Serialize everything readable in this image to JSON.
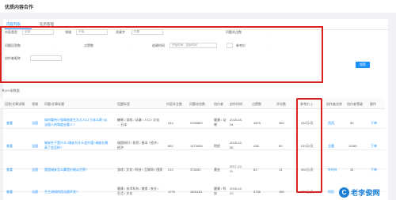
{
  "header": {
    "title": "优质内容合作"
  },
  "tabs": [
    {
      "label": "内容列表"
    },
    {
      "label": "任务管理"
    }
  ],
  "filters": {
    "content_type_label": "内容类型",
    "content_type_value": "全部",
    "domain_label": "领域",
    "domain_value": "不限",
    "keyword_label": "关键字",
    "keyword_value": "标题",
    "visits_label": "问题关注数",
    "visits_value": "-",
    "question_answer_label": "问题回答数",
    "question_answer_value": "-",
    "likes_label": "点赞数",
    "likes_value": "-",
    "create_time_label": "创建时间",
    "create_time_value": "开始时间 - 结束时间",
    "ref_label": "参考价",
    "ref_value": "-",
    "author_label": "创作者昵称",
    "search_btn": "搜索"
  },
  "summary": {
    "total": "共497条数据"
  },
  "table": {
    "headers": [
      "回答/文章详情",
      "领域",
      "问题/文章标题",
      "话题标签",
      "内容关注数",
      "问题浏览数",
      "创作者",
      "创作时间",
      "点赞数",
      "评论数",
      "参考价",
      "创作者名称",
      "创作者等级",
      "操作"
    ],
    "rows": [
      {
        "link": "查看",
        "domain": "法国",
        "title": "如何看待小强和修发生为几人口 日本么呢?从法国人的角度去看人?",
        "tags": "糖果 / 游戏 / 动漫 / 人口 / 文化 ... 日本",
        "follows": "414",
        "views": "2045563",
        "author": "健康 / 动物",
        "date": "2018-04-24",
        "likes": "4878",
        "comments": "360",
        "price": "432元/天",
        "author_name": "西西",
        "level": "50",
        "action": "下单"
      },
      {
        "link": "查看",
        "domain": "法国",
        "title": "瑞安在于是什么?瑞安为什么会升值?瑞安价格高了会怎样?",
        "tags": "瑞国知识 / 投资 / 基本 / 经济 / 经济",
        "follows": "862",
        "views": "1373406",
        "author": "财经",
        "date": "2018-02-06",
        "likes": "436",
        "comments": "60",
        "price": "210元/天",
        "author_name": "全墨",
        "level": "11180",
        "action": "下单"
      },
      {
        "link": "查看",
        "domain": "法国",
        "title": "我国瑞安怎么算是价格从世界?",
        "tags": "游戏 / 文化 / 科技 / 互联网 / 国家",
        "follows": "212",
        "views": "378453",
        "author": "基金",
        "date": "2017-12-11",
        "likes": "83",
        "comments": "14",
        "price": "492元/天",
        "author_name": "叶叶叶",
        "level": "34",
        "action": "下单"
      },
      {
        "link": "查看",
        "domain": "法国",
        "title": "不主流如何用法国开发?",
        "tags": "健康 / 技术科技 / 美食 / 农业 / 生活 / 文化",
        "follows": "1276",
        "views": "1601181",
        "author": "健康 / 科技",
        "date": "2018-02-23",
        "likes": "3736",
        "comments": "160",
        "price": "770元/天",
        "author_name": "阿民",
        "level": "",
        "action": "下单"
      }
    ]
  },
  "watermark": {
    "text": "老李俊网",
    "mark": "C"
  },
  "colors": {
    "accent": "#1890ff",
    "highlight": "#d9211f",
    "brand": "#1b7fd8"
  }
}
